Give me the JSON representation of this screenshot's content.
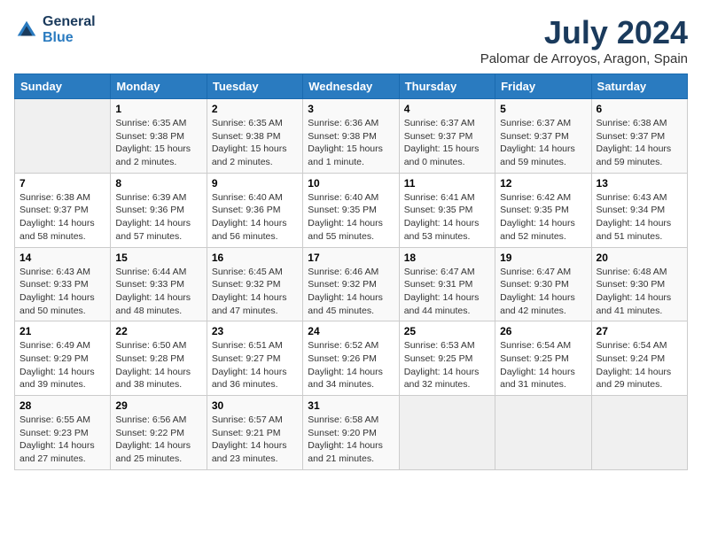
{
  "header": {
    "logo_line1": "General",
    "logo_line2": "Blue",
    "month_year": "July 2024",
    "location": "Palomar de Arroyos, Aragon, Spain"
  },
  "weekdays": [
    "Sunday",
    "Monday",
    "Tuesday",
    "Wednesday",
    "Thursday",
    "Friday",
    "Saturday"
  ],
  "weeks": [
    [
      {
        "day": "",
        "info": ""
      },
      {
        "day": "1",
        "info": "Sunrise: 6:35 AM\nSunset: 9:38 PM\nDaylight: 15 hours\nand 2 minutes."
      },
      {
        "day": "2",
        "info": "Sunrise: 6:35 AM\nSunset: 9:38 PM\nDaylight: 15 hours\nand 2 minutes."
      },
      {
        "day": "3",
        "info": "Sunrise: 6:36 AM\nSunset: 9:38 PM\nDaylight: 15 hours\nand 1 minute."
      },
      {
        "day": "4",
        "info": "Sunrise: 6:37 AM\nSunset: 9:37 PM\nDaylight: 15 hours\nand 0 minutes."
      },
      {
        "day": "5",
        "info": "Sunrise: 6:37 AM\nSunset: 9:37 PM\nDaylight: 14 hours\nand 59 minutes."
      },
      {
        "day": "6",
        "info": "Sunrise: 6:38 AM\nSunset: 9:37 PM\nDaylight: 14 hours\nand 59 minutes."
      }
    ],
    [
      {
        "day": "7",
        "info": "Sunrise: 6:38 AM\nSunset: 9:37 PM\nDaylight: 14 hours\nand 58 minutes."
      },
      {
        "day": "8",
        "info": "Sunrise: 6:39 AM\nSunset: 9:36 PM\nDaylight: 14 hours\nand 57 minutes."
      },
      {
        "day": "9",
        "info": "Sunrise: 6:40 AM\nSunset: 9:36 PM\nDaylight: 14 hours\nand 56 minutes."
      },
      {
        "day": "10",
        "info": "Sunrise: 6:40 AM\nSunset: 9:35 PM\nDaylight: 14 hours\nand 55 minutes."
      },
      {
        "day": "11",
        "info": "Sunrise: 6:41 AM\nSunset: 9:35 PM\nDaylight: 14 hours\nand 53 minutes."
      },
      {
        "day": "12",
        "info": "Sunrise: 6:42 AM\nSunset: 9:35 PM\nDaylight: 14 hours\nand 52 minutes."
      },
      {
        "day": "13",
        "info": "Sunrise: 6:43 AM\nSunset: 9:34 PM\nDaylight: 14 hours\nand 51 minutes."
      }
    ],
    [
      {
        "day": "14",
        "info": "Sunrise: 6:43 AM\nSunset: 9:33 PM\nDaylight: 14 hours\nand 50 minutes."
      },
      {
        "day": "15",
        "info": "Sunrise: 6:44 AM\nSunset: 9:33 PM\nDaylight: 14 hours\nand 48 minutes."
      },
      {
        "day": "16",
        "info": "Sunrise: 6:45 AM\nSunset: 9:32 PM\nDaylight: 14 hours\nand 47 minutes."
      },
      {
        "day": "17",
        "info": "Sunrise: 6:46 AM\nSunset: 9:32 PM\nDaylight: 14 hours\nand 45 minutes."
      },
      {
        "day": "18",
        "info": "Sunrise: 6:47 AM\nSunset: 9:31 PM\nDaylight: 14 hours\nand 44 minutes."
      },
      {
        "day": "19",
        "info": "Sunrise: 6:47 AM\nSunset: 9:30 PM\nDaylight: 14 hours\nand 42 minutes."
      },
      {
        "day": "20",
        "info": "Sunrise: 6:48 AM\nSunset: 9:30 PM\nDaylight: 14 hours\nand 41 minutes."
      }
    ],
    [
      {
        "day": "21",
        "info": "Sunrise: 6:49 AM\nSunset: 9:29 PM\nDaylight: 14 hours\nand 39 minutes."
      },
      {
        "day": "22",
        "info": "Sunrise: 6:50 AM\nSunset: 9:28 PM\nDaylight: 14 hours\nand 38 minutes."
      },
      {
        "day": "23",
        "info": "Sunrise: 6:51 AM\nSunset: 9:27 PM\nDaylight: 14 hours\nand 36 minutes."
      },
      {
        "day": "24",
        "info": "Sunrise: 6:52 AM\nSunset: 9:26 PM\nDaylight: 14 hours\nand 34 minutes."
      },
      {
        "day": "25",
        "info": "Sunrise: 6:53 AM\nSunset: 9:25 PM\nDaylight: 14 hours\nand 32 minutes."
      },
      {
        "day": "26",
        "info": "Sunrise: 6:54 AM\nSunset: 9:25 PM\nDaylight: 14 hours\nand 31 minutes."
      },
      {
        "day": "27",
        "info": "Sunrise: 6:54 AM\nSunset: 9:24 PM\nDaylight: 14 hours\nand 29 minutes."
      }
    ],
    [
      {
        "day": "28",
        "info": "Sunrise: 6:55 AM\nSunset: 9:23 PM\nDaylight: 14 hours\nand 27 minutes."
      },
      {
        "day": "29",
        "info": "Sunrise: 6:56 AM\nSunset: 9:22 PM\nDaylight: 14 hours\nand 25 minutes."
      },
      {
        "day": "30",
        "info": "Sunrise: 6:57 AM\nSunset: 9:21 PM\nDaylight: 14 hours\nand 23 minutes."
      },
      {
        "day": "31",
        "info": "Sunrise: 6:58 AM\nSunset: 9:20 PM\nDaylight: 14 hours\nand 21 minutes."
      },
      {
        "day": "",
        "info": ""
      },
      {
        "day": "",
        "info": ""
      },
      {
        "day": "",
        "info": ""
      }
    ]
  ]
}
